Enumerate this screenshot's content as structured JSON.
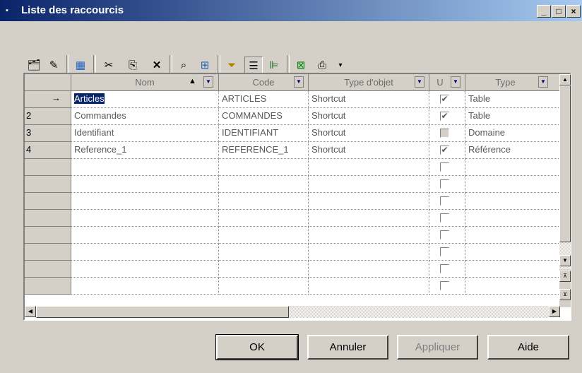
{
  "window": {
    "title": "Liste des raccourcis"
  },
  "toolbar": {
    "icons": [
      "properties-icon",
      "edit-icon",
      "insert-icon",
      "cut-icon",
      "copy-icon",
      "delete-icon",
      "find-icon",
      "replace-icon",
      "filter-icon",
      "filter-active-icon",
      "customize-columns-icon",
      "excel-icon",
      "print-icon",
      "dropdown-icon"
    ]
  },
  "grid": {
    "columns": [
      "Nom",
      "Code",
      "Type d'objet",
      "U",
      "Type"
    ],
    "current_row_marker": "→",
    "rows": [
      {
        "num": "",
        "name": "Articles",
        "code": "ARTICLES",
        "objtype": "Shortcut",
        "u": true,
        "type": "Table"
      },
      {
        "num": "2",
        "name": "Commandes",
        "code": "COMMANDES",
        "objtype": "Shortcut",
        "u": true,
        "type": "Table"
      },
      {
        "num": "3",
        "name": "Identifiant",
        "code": "IDENTIFIANT",
        "objtype": "Shortcut",
        "u": false,
        "type": "Domaine"
      },
      {
        "num": "4",
        "name": "Reference_1",
        "code": "REFERENCE_1",
        "objtype": "Shortcut",
        "u": true,
        "type": "Référence"
      }
    ]
  },
  "buttons": {
    "ok": "OK",
    "cancel": "Annuler",
    "apply": "Appliquer",
    "help": "Aide"
  }
}
